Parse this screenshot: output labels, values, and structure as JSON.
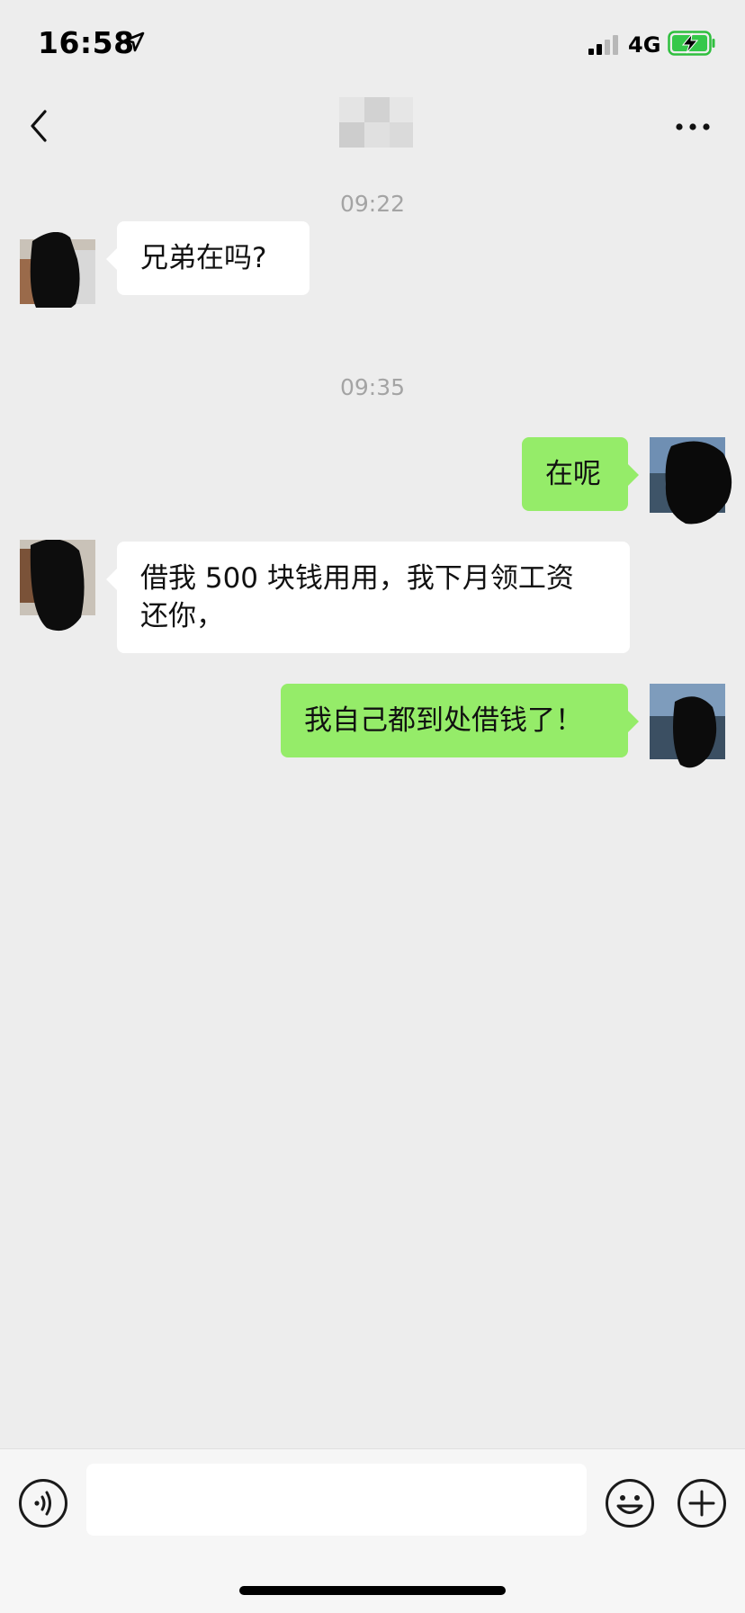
{
  "status_bar": {
    "time": "16:58",
    "network": "4G",
    "icons": [
      "location-arrow-icon",
      "signal-icon",
      "battery-charging-icon"
    ]
  },
  "nav": {
    "icons": [
      "back-chevron-icon",
      "more-icon"
    ]
  },
  "chat": {
    "timestamps": [
      "09:22",
      "09:35"
    ],
    "messages": [
      {
        "side": "left",
        "text": "兄弟在吗?"
      },
      {
        "side": "right",
        "text": "在呢"
      },
      {
        "side": "left",
        "text_line1": "借我 500 块钱用用，我下月领工资",
        "text_line2": "还你，"
      },
      {
        "side": "right",
        "text": "我自己都到处借钱了！"
      }
    ]
  },
  "input_bar": {
    "text_value": "",
    "icons": [
      "voice-icon",
      "emoji-icon",
      "plus-icon"
    ]
  },
  "colors": {
    "background": "#ededed",
    "bubble_self": "#95ec69",
    "bubble_other": "#ffffff",
    "timestamp": "#a4a4a4"
  }
}
